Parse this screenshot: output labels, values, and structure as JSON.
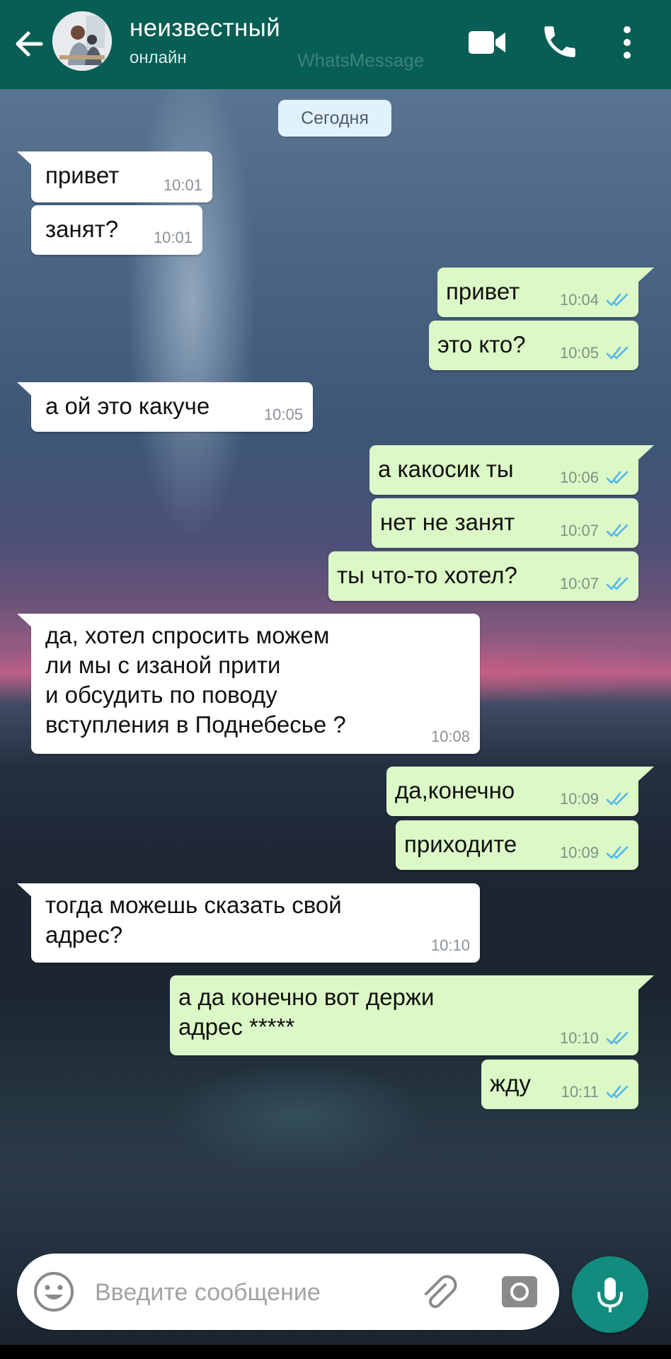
{
  "header": {
    "contact_name": "неизвестный",
    "status": "онлайн",
    "watermark": "WhatsMessage",
    "back_icon": "arrow-left-icon",
    "video_icon": "video-camera-icon",
    "call_icon": "phone-icon",
    "menu_icon": "more-vertical-icon",
    "bar_color": "#075e54"
  },
  "date_chip": "Сегодня",
  "messages": [
    {
      "dir": "in",
      "lines": [
        "привет"
      ],
      "time": "10:01"
    },
    {
      "dir": "in",
      "lines": [
        "занят?"
      ],
      "time": "10:01"
    },
    {
      "dir": "out",
      "lines": [
        "привет"
      ],
      "time": "10:04",
      "read": true
    },
    {
      "dir": "out",
      "lines": [
        "это кто?"
      ],
      "time": "10:05",
      "read": true
    },
    {
      "dir": "in",
      "lines": [
        "а ой это какуче"
      ],
      "time": "10:05"
    },
    {
      "dir": "out",
      "lines": [
        "а какосик ты"
      ],
      "time": "10:06",
      "read": true
    },
    {
      "dir": "out",
      "lines": [
        "нет не занят"
      ],
      "time": "10:07",
      "read": true
    },
    {
      "dir": "out",
      "lines": [
        "ты что-то хотел?"
      ],
      "time": "10:07",
      "read": true
    },
    {
      "dir": "in",
      "lines": [
        "да, хотел спросить можем",
        "ли мы с изаной прити",
        "и обсудить по поводу",
        "вступления в Поднебесье ?"
      ],
      "time": "10:08"
    },
    {
      "dir": "out",
      "lines": [
        "да,конечно"
      ],
      "time": "10:09",
      "read": true
    },
    {
      "dir": "out",
      "lines": [
        "приходите"
      ],
      "time": "10:09",
      "read": true
    },
    {
      "dir": "in",
      "lines": [
        "тогда можешь сказать свой",
        "адрес?"
      ],
      "time": "10:10"
    },
    {
      "dir": "out",
      "lines": [
        "а да конечно вот держи",
        "адрес *****"
      ],
      "time": "10:10",
      "read": true
    },
    {
      "dir": "out",
      "lines": [
        "жду"
      ],
      "time": "10:11",
      "read": true
    }
  ],
  "input": {
    "placeholder": "Введите сообщение",
    "emoji_icon": "emoji-icon",
    "attach_icon": "paperclip-icon",
    "camera_icon": "camera-icon",
    "mic_icon": "microphone-icon"
  },
  "colors": {
    "incoming_bubble": "#ffffff",
    "outgoing_bubble": "#dcf8c6",
    "read_ticks": "#4fb6ec",
    "mic_button": "#128c7e"
  }
}
